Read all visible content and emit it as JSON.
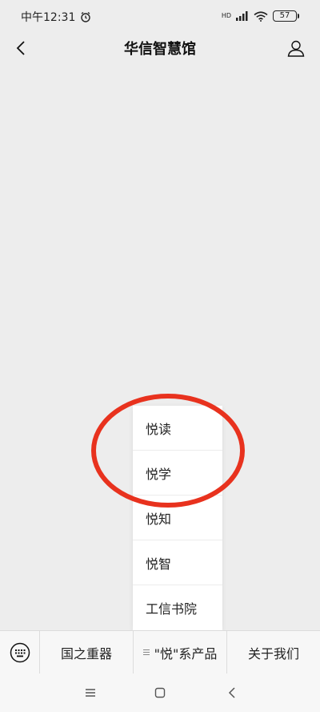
{
  "status_bar": {
    "time": "中午12:31",
    "network": "HD",
    "battery": "57"
  },
  "header": {
    "title": "华信智慧馆"
  },
  "popup_menu": {
    "items": [
      "悦读",
      "悦学",
      "悦知",
      "悦智",
      "工信书院"
    ]
  },
  "bottom_menu": {
    "tabs": [
      "国之重器",
      "\"悦\"系产品",
      "关于我们"
    ]
  },
  "annotation": {
    "color": "#e8321e"
  }
}
